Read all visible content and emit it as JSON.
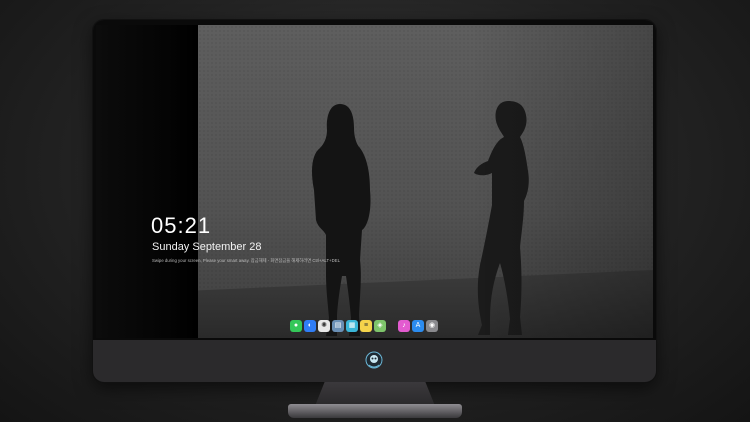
{
  "lockscreen": {
    "time": "05:21",
    "date": "Sunday September  28",
    "hint": "Swipe during your screen, Please your smart away. 잠금해제 - 화면잠금을 해제하려면 Ctrl+ALT+DEL"
  },
  "dock": {
    "apps": [
      {
        "name": "messages-icon",
        "color": "#34c759",
        "glyph": "●"
      },
      {
        "name": "finder-icon",
        "color": "#2f7df6",
        "glyph": "◐"
      },
      {
        "name": "safari-icon",
        "color": "#e8e8e8",
        "glyph": "✺"
      },
      {
        "name": "preview-icon",
        "color": "#6a8fb5",
        "glyph": "▤"
      },
      {
        "name": "claquette-icon",
        "color": "#3bb6d8",
        "glyph": "▦"
      },
      {
        "name": "notes-icon",
        "color": "#f5d44b",
        "glyph": "≡"
      },
      {
        "name": "photos-icon",
        "color": "#7ec46b",
        "glyph": "◈"
      },
      {
        "name": "itunes-icon",
        "color": "#e35bd0",
        "glyph": "♪"
      },
      {
        "name": "app-store-icon",
        "color": "#2b8cf0",
        "glyph": "A"
      },
      {
        "name": "camera-icon",
        "color": "#8a8a8e",
        "glyph": "◉"
      }
    ]
  },
  "colors": {
    "monitor_frame": "#2b2a2c",
    "wallpaper": "#525252"
  }
}
